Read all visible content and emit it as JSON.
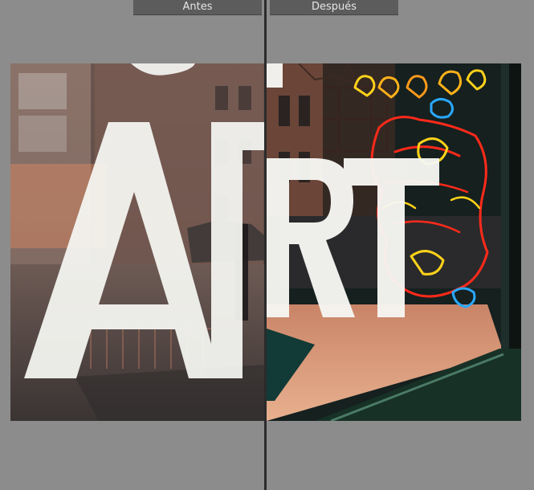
{
  "compare": {
    "before_label": "Antes",
    "after_label": "Después"
  },
  "photo": {
    "window_text": "ART"
  },
  "colors": {
    "background": "#8c8c8c",
    "tab_background": "#5c5c5c",
    "tab_text": "#e6e6e6",
    "divider": "#2b2b2b",
    "neon_red": "#ff2a1a",
    "neon_yellow": "#ffd21a",
    "neon_blue": "#2aa8ff"
  }
}
